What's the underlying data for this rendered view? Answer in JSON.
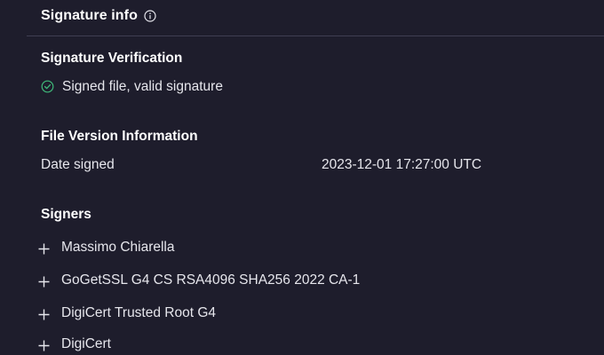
{
  "header": {
    "title": "Signature info",
    "info_icon": "info-icon"
  },
  "verification": {
    "heading": "Signature Verification",
    "status_icon": "check-circle-icon",
    "status_text": "Signed file, valid signature",
    "status_color": "#3fb97a"
  },
  "file_version": {
    "heading": "File Version Information",
    "rows": [
      {
        "label": "Date signed",
        "value": "2023-12-01 17:27:00 UTC"
      }
    ]
  },
  "signers": {
    "heading": "Signers",
    "expand_icon": "plus-icon",
    "items": [
      {
        "name": "Massimo Chiarella"
      },
      {
        "name": "GoGetSSL G4 CS RSA4096 SHA256 2022 CA-1"
      },
      {
        "name": "DigiCert Trusted Root G4"
      },
      {
        "name": "DigiCert"
      }
    ]
  },
  "colors": {
    "background": "#1e1d2c",
    "divider": "#3f3e52",
    "text": "#e9e9ee"
  }
}
